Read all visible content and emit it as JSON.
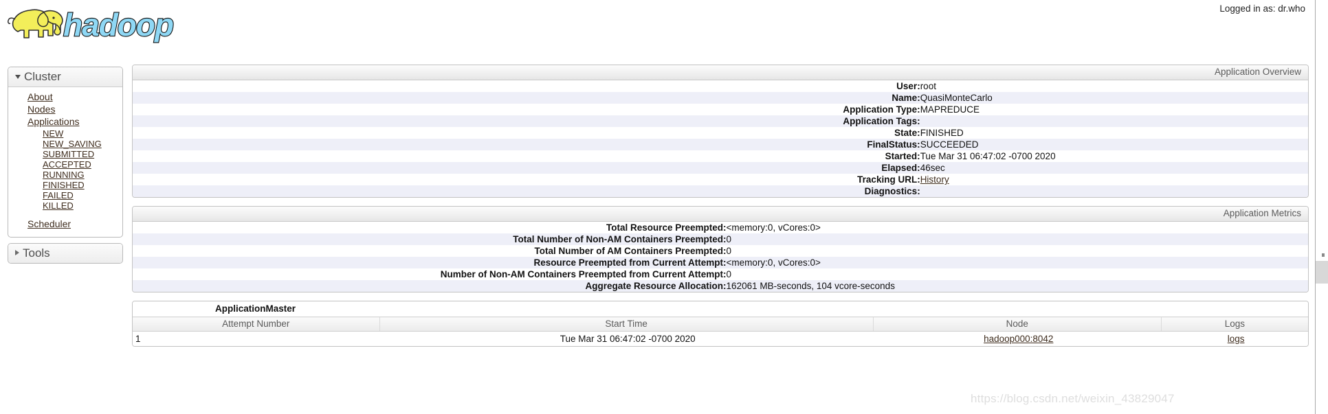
{
  "header": {
    "logo_text": "hadoop",
    "logo_alt": "hadoop-elephant-logo",
    "logged_in": "Logged in as: dr.who"
  },
  "sidebar": {
    "blocks": [
      {
        "title": "Cluster",
        "expanded": true,
        "items": [
          {
            "label": "About",
            "level": 1
          },
          {
            "label": "Nodes",
            "level": 1
          },
          {
            "label": "Applications",
            "level": 1
          },
          {
            "label": "NEW",
            "level": 2
          },
          {
            "label": "NEW_SAVING",
            "level": 2
          },
          {
            "label": "SUBMITTED",
            "level": 2
          },
          {
            "label": "ACCEPTED",
            "level": 2
          },
          {
            "label": "RUNNING",
            "level": 2
          },
          {
            "label": "FINISHED",
            "level": 2
          },
          {
            "label": "FAILED",
            "level": 2
          },
          {
            "label": "KILLED",
            "level": 2
          },
          {
            "label": "Scheduler",
            "level": 1,
            "gap": true
          }
        ]
      },
      {
        "title": "Tools",
        "expanded": false,
        "items": []
      }
    ]
  },
  "overview": {
    "heading": "Application Overview",
    "rows": [
      {
        "key": "User:",
        "value": "root"
      },
      {
        "key": "Name:",
        "value": "QuasiMonteCarlo"
      },
      {
        "key": "Application Type:",
        "value": "MAPREDUCE"
      },
      {
        "key": "Application Tags:",
        "value": ""
      },
      {
        "key": "State:",
        "value": "FINISHED"
      },
      {
        "key": "FinalStatus:",
        "value": "SUCCEEDED"
      },
      {
        "key": "Started:",
        "value": "Tue Mar 31 06:47:02 -0700 2020"
      },
      {
        "key": "Elapsed:",
        "value": "46sec"
      },
      {
        "key": "Tracking URL:",
        "value": "History",
        "link": true
      },
      {
        "key": "Diagnostics:",
        "value": ""
      }
    ]
  },
  "metrics": {
    "heading": "Application Metrics",
    "rows": [
      {
        "key": "Total Resource Preempted:",
        "value": "<memory:0, vCores:0>"
      },
      {
        "key": "Total Number of Non-AM Containers Preempted:",
        "value": "0"
      },
      {
        "key": "Total Number of AM Containers Preempted:",
        "value": "0"
      },
      {
        "key": "Resource Preempted from Current Attempt:",
        "value": "<memory:0, vCores:0>"
      },
      {
        "key": "Number of Non-AM Containers Preempted from Current Attempt:",
        "value": "0"
      },
      {
        "key": "Aggregate Resource Allocation:",
        "value": "162061 MB-seconds, 104 vcore-seconds"
      }
    ]
  },
  "app_master": {
    "caption": "ApplicationMaster",
    "columns": [
      "Attempt Number",
      "Start Time",
      "Node",
      "Logs"
    ],
    "rows": [
      {
        "attempt_number": "1",
        "start_time": "Tue Mar 31 06:47:02 -0700 2020",
        "node": "hadoop000:8042",
        "logs": "logs"
      }
    ]
  },
  "watermark": {
    "text": "https://blog.csdn.net/weixin_43829047"
  },
  "colors": {
    "row_alt": "#eeeff8",
    "link": "#3f2d1e",
    "logo_blue": "#8fd8f5",
    "logo_yellow": "#f3ee5a"
  }
}
